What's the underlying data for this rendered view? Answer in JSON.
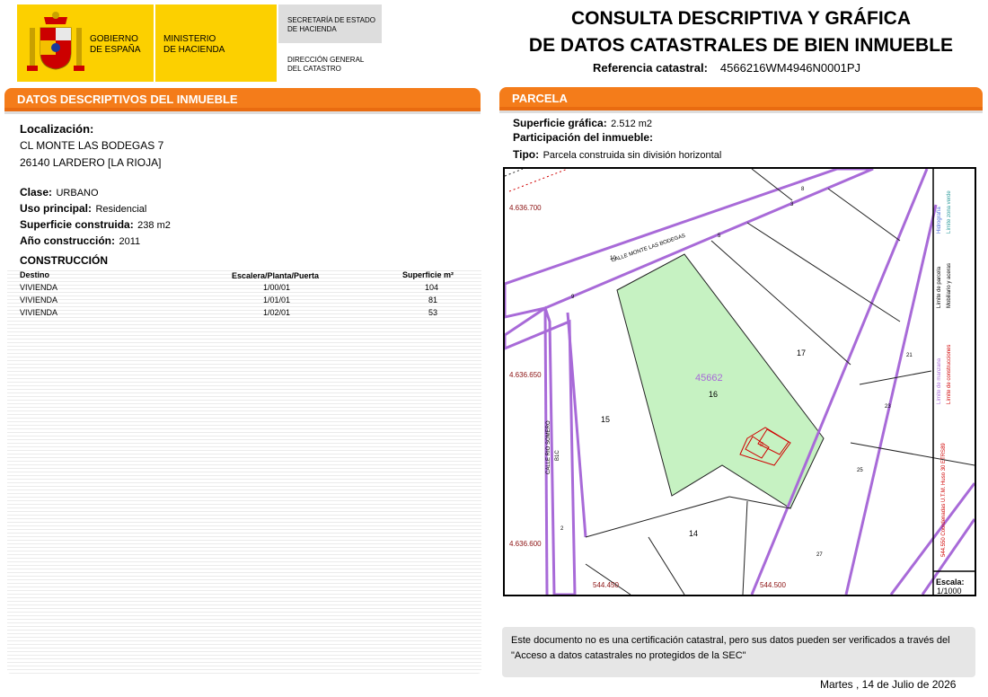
{
  "header": {
    "gobierno": [
      "GOBIERNO",
      "DE ESPAÑA"
    ],
    "ministerio": [
      "MINISTERIO",
      "DE HACIENDA"
    ],
    "secretaria": [
      "SECRETARÍA DE ESTADO",
      "DE HACIENDA"
    ],
    "direccion": [
      "DIRECCIÓN GENERAL",
      "DEL CATASTRO"
    ],
    "title_line1": "CONSULTA DESCRIPTIVA Y GRÁFICA",
    "title_line2": "DE DATOS CATASTRALES DE BIEN INMUEBLE",
    "ref_label": "Referencia catastral:",
    "ref_value": "4566216WM4946N0001PJ"
  },
  "left": {
    "section_title": "DATOS DESCRIPTIVOS DEL INMUEBLE",
    "localizacion_label": "Localización:",
    "address1": "CL MONTE LAS BODEGAS 7",
    "address2": "26140 LARDERO [LA RIOJA]",
    "clase_label": "Clase:",
    "clase_value": "URBANO",
    "uso_label": "Uso principal:",
    "uso_value": "Residencial",
    "sup_label": "Superficie construida:",
    "sup_value": "238 m2",
    "anio_label": "Año construcción:",
    "anio_value": "2011",
    "construccion_title": "CONSTRUCCIÓN",
    "columns": [
      "Destino",
      "Escalera/Planta/Puerta",
      "Superficie m²"
    ],
    "rows": [
      [
        "VIVIENDA",
        "1/00/01",
        "104"
      ],
      [
        "VIVIENDA",
        "1/01/01",
        "81"
      ],
      [
        "VIVIENDA",
        "1/02/01",
        "53"
      ]
    ]
  },
  "right": {
    "section_title": "PARCELA",
    "sup_grafica_label": "Superficie gráfica:",
    "sup_grafica_value": "2.512 m2",
    "participacion_label": "Participación del inmueble:",
    "tipo_label": "Tipo:",
    "tipo_value": "Parcela construida sin división horizontal"
  },
  "map": {
    "coord_y1": "4.636.700",
    "coord_y2": "4.636.650",
    "coord_y3": "4.636.600",
    "coord_x1": "544.450",
    "coord_x2": "544.500",
    "street1": "CALLE MONTE LAS BODEGAS",
    "street2_a": "CALLE RIO SOMERO",
    "street2_b": "B1C",
    "parcel_ref": "45662",
    "parcel_labels": [
      "17",
      "16",
      "15",
      "14"
    ],
    "road_numbers": [
      "8",
      "3",
      "5",
      "10",
      "9",
      "21",
      "23",
      "25",
      "27",
      "2"
    ],
    "building_label": "II",
    "legend": [
      "Hidrografía",
      "Límite zona verde",
      "Límite de parcela",
      "Mobiliario y aceras",
      "Límite de manzana",
      "Límite de construcciones"
    ],
    "coords_note": "544.550 Coordenadas U.T.M. Huso 30 ETRS89",
    "escala_label": "Escala:",
    "escala_value": "1/1000",
    "colors": {
      "parcel": "#c6f2c2",
      "road": "#a86ad8",
      "build": "#d00000",
      "coord": "#8b1010"
    }
  },
  "footer": {
    "notice": "Este documento no es una certificación catastral, pero sus datos pueden ser verificados a través del \"Acceso a datos catastrales no protegidos de la SEC\"",
    "date": "Martes , 14 de Julio de 2026"
  }
}
